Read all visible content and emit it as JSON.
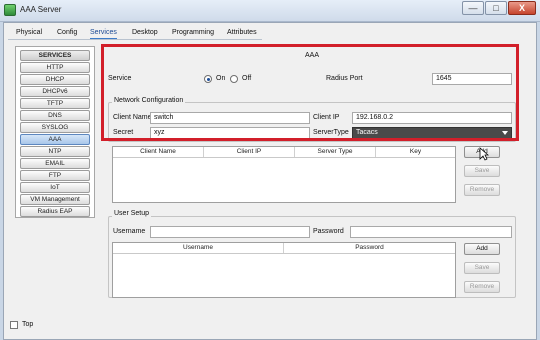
{
  "window": {
    "title": "AAA Server",
    "minimize_label": "—",
    "maximize_label": "□",
    "close_label": "X"
  },
  "tabs": [
    {
      "label": "Physical",
      "active": false
    },
    {
      "label": "Config",
      "active": false
    },
    {
      "label": "Services",
      "active": true
    },
    {
      "label": "Desktop",
      "active": false
    },
    {
      "label": "Programming",
      "active": false
    },
    {
      "label": "Attributes",
      "active": false
    }
  ],
  "sidebar": {
    "header": "SERVICES",
    "items": [
      "HTTP",
      "DHCP",
      "DHCPv6",
      "TFTP",
      "DNS",
      "SYSLOG",
      "AAA",
      "NTP",
      "EMAIL",
      "FTP",
      "IoT",
      "VM Management",
      "Radius EAP"
    ],
    "active_item": "AAA"
  },
  "aaa": {
    "title": "AAA",
    "service_label": "Service",
    "on_label": "On",
    "off_label": "Off",
    "service_on": true,
    "radius_port_label": "Radius Port",
    "radius_port_value": "1645",
    "network_config_title": "Network Configuration",
    "client_name_label": "Client Name",
    "client_name_value": "switch",
    "client_ip_label": "Client IP",
    "client_ip_value": "192.168.0.2",
    "secret_label": "Secret",
    "secret_value": "xyz",
    "server_type_label": "ServerType",
    "server_type_value": "Tacacs",
    "client_table_headers": [
      "Client Name",
      "Client IP",
      "Server Type",
      "Key"
    ],
    "add_label": "Add",
    "save_label": "Save",
    "remove_label": "Remove"
  },
  "user_setup": {
    "title": "User Setup",
    "username_label": "Username",
    "username_value": "",
    "password_label": "Password",
    "password_value": "",
    "table_headers": [
      "Username",
      "Password"
    ],
    "add_label": "Add",
    "save_label": "Save",
    "remove_label": "Remove"
  },
  "footer": {
    "top_label": "Top",
    "top_checked": false
  },
  "colors": {
    "highlight_border": "#d21f2a",
    "active_tab": "#3d7cc9",
    "select_bg": "#4a4a4a"
  }
}
